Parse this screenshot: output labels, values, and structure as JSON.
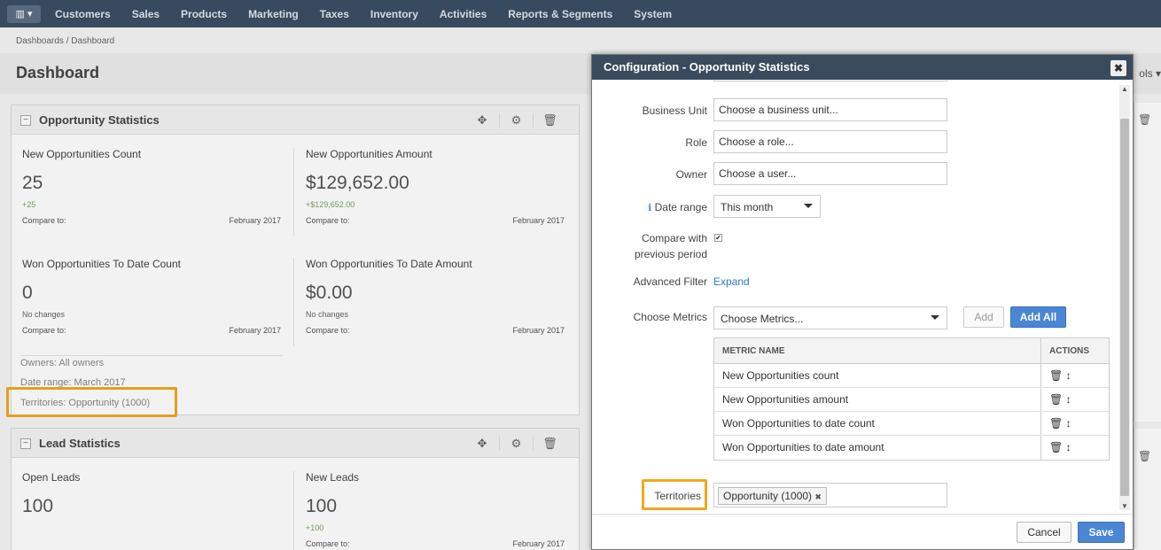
{
  "nav": {
    "items": [
      "Customers",
      "Sales",
      "Products",
      "Marketing",
      "Taxes",
      "Inventory",
      "Activities",
      "Reports & Segments",
      "System"
    ]
  },
  "breadcrumb": "Dashboards / Dashboard",
  "page": {
    "title": "Dashboard",
    "tools_label": "ols"
  },
  "opportunity_widget": {
    "title": "Opportunity Statistics",
    "metrics": [
      {
        "label": "New Opportunities Count",
        "value": "25",
        "change": "+25",
        "compare_label": "Compare to:",
        "compare_value": "February 2017"
      },
      {
        "label": "New Opportunities Amount",
        "value": "$129,652.00",
        "change": "+$129,652.00",
        "compare_label": "Compare to:",
        "compare_value": "February 2017"
      },
      {
        "label": "Won Opportunities To Date Count",
        "value": "0",
        "change": "No changes",
        "compare_label": "Compare to:",
        "compare_value": "February 2017"
      },
      {
        "label": "Won Opportunities To Date Amount",
        "value": "$0.00",
        "change": "No changes",
        "compare_label": "Compare to:",
        "compare_value": "February 2017"
      }
    ],
    "owners": "Owners: All owners",
    "date_range": "Date range: March 2017",
    "territories": "Territories: Opportunity (1000)"
  },
  "lead_widget": {
    "title": "Lead Statistics",
    "metrics": [
      {
        "label": "Open Leads",
        "value": "100",
        "change": "",
        "compare_label": "",
        "compare_value": ""
      },
      {
        "label": "New Leads",
        "value": "100",
        "change": "+100",
        "compare_label": "Compare to:",
        "compare_value": "February 2017"
      }
    ]
  },
  "modal": {
    "title": "Configuration - Opportunity Statistics",
    "close": "✖",
    "business_unit": {
      "label": "Business Unit",
      "placeholder": "Choose a business unit..."
    },
    "role": {
      "label": "Role",
      "placeholder": "Choose a role..."
    },
    "owner": {
      "label": "Owner",
      "placeholder": "Choose a user..."
    },
    "date_range": {
      "label": "Date range",
      "value": "This month"
    },
    "compare": {
      "label1": "Compare with",
      "label2": "previous period",
      "checked": true
    },
    "advanced_filter": {
      "label": "Advanced Filter",
      "link": "Expand"
    },
    "metrics": {
      "label": "Choose Metrics",
      "placeholder": "Choose Metrics...",
      "add": "Add",
      "add_all": "Add All",
      "col_name": "METRIC NAME",
      "col_actions": "ACTIONS",
      "rows": [
        "New Opportunities count",
        "New Opportunities amount",
        "Won Opportunities to date count",
        "Won Opportunities to date amount"
      ]
    },
    "territories": {
      "label": "Territories",
      "tag": "Opportunity (1000)",
      "tag_remove": "✖"
    },
    "cancel": "Cancel",
    "save": "Save"
  },
  "colors": {
    "nav_bg": "#3c4f63",
    "accent": "#4a86d4",
    "highlight": "#f0a820",
    "change_positive": "#7aa35a"
  }
}
